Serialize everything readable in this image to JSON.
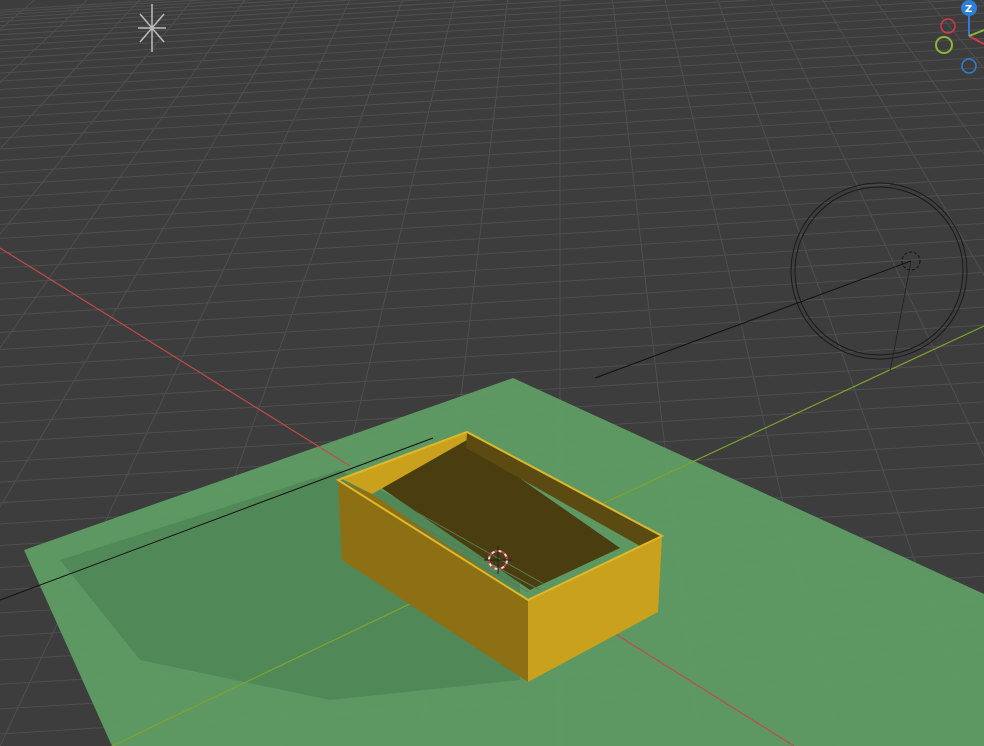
{
  "viewport": {
    "background_color": "#3d3d3d",
    "grid_color": "#4f4f4f",
    "x_axis_color": "#c24a4a",
    "y_axis_color": "#7fa32e"
  },
  "scene": {
    "ground_plane_color": "#5f9f66",
    "box_color": "#c9a11c",
    "box_shadow_color": "#4a3d10",
    "light_object": "sun-lamp",
    "camera_object": "camera",
    "cursor_object": "3d-cursor"
  },
  "gizmo": {
    "z_label": "Z",
    "z_color": "#2f7fd6",
    "x_color": "#d43a4a",
    "y_color": "#8cb53a"
  }
}
